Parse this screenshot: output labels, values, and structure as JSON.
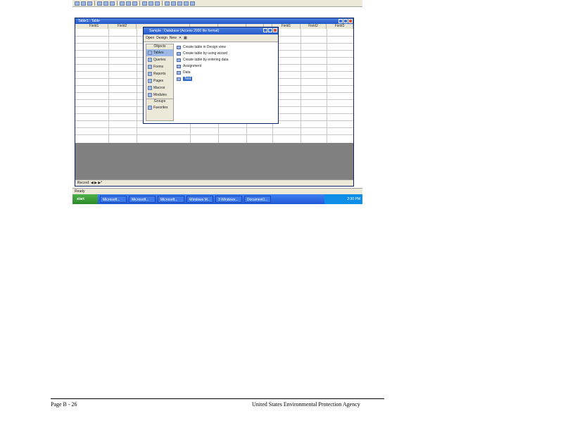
{
  "screenshot": {
    "table_window": {
      "title": "Table1 : Table",
      "columns": [
        "Field1",
        "Field2",
        "",
        "",
        "",
        "",
        "",
        "Field1",
        "Field2",
        "Field3"
      ],
      "record_nav": "Record:"
    },
    "db_window": {
      "title": "Sample : Database (Access 2000 file format)",
      "tools": [
        "Open",
        "Design",
        "New"
      ],
      "objects_header": "Objects",
      "objects": [
        "Tables",
        "Queries",
        "Forms",
        "Reports",
        "Pages",
        "Macros",
        "Modules"
      ],
      "groups_header": "Groups",
      "groups": [
        "Favorites"
      ],
      "list_items": [
        "Create table in Design view",
        "Create table by using wizard",
        "Create table by entering data",
        "Assignment",
        "Data",
        "Test"
      ]
    },
    "status_text": "Ready",
    "taskbar": {
      "start": "start",
      "tasks": [
        "Microsoft...",
        "Microsoft...",
        "Microsoft...",
        "Windows M...",
        "3 Windows...",
        "Document1..."
      ],
      "clock": "2:30 PM"
    }
  },
  "footer": {
    "left": "Page B   - 26",
    "right": "United States Environmental Protection Agency"
  }
}
